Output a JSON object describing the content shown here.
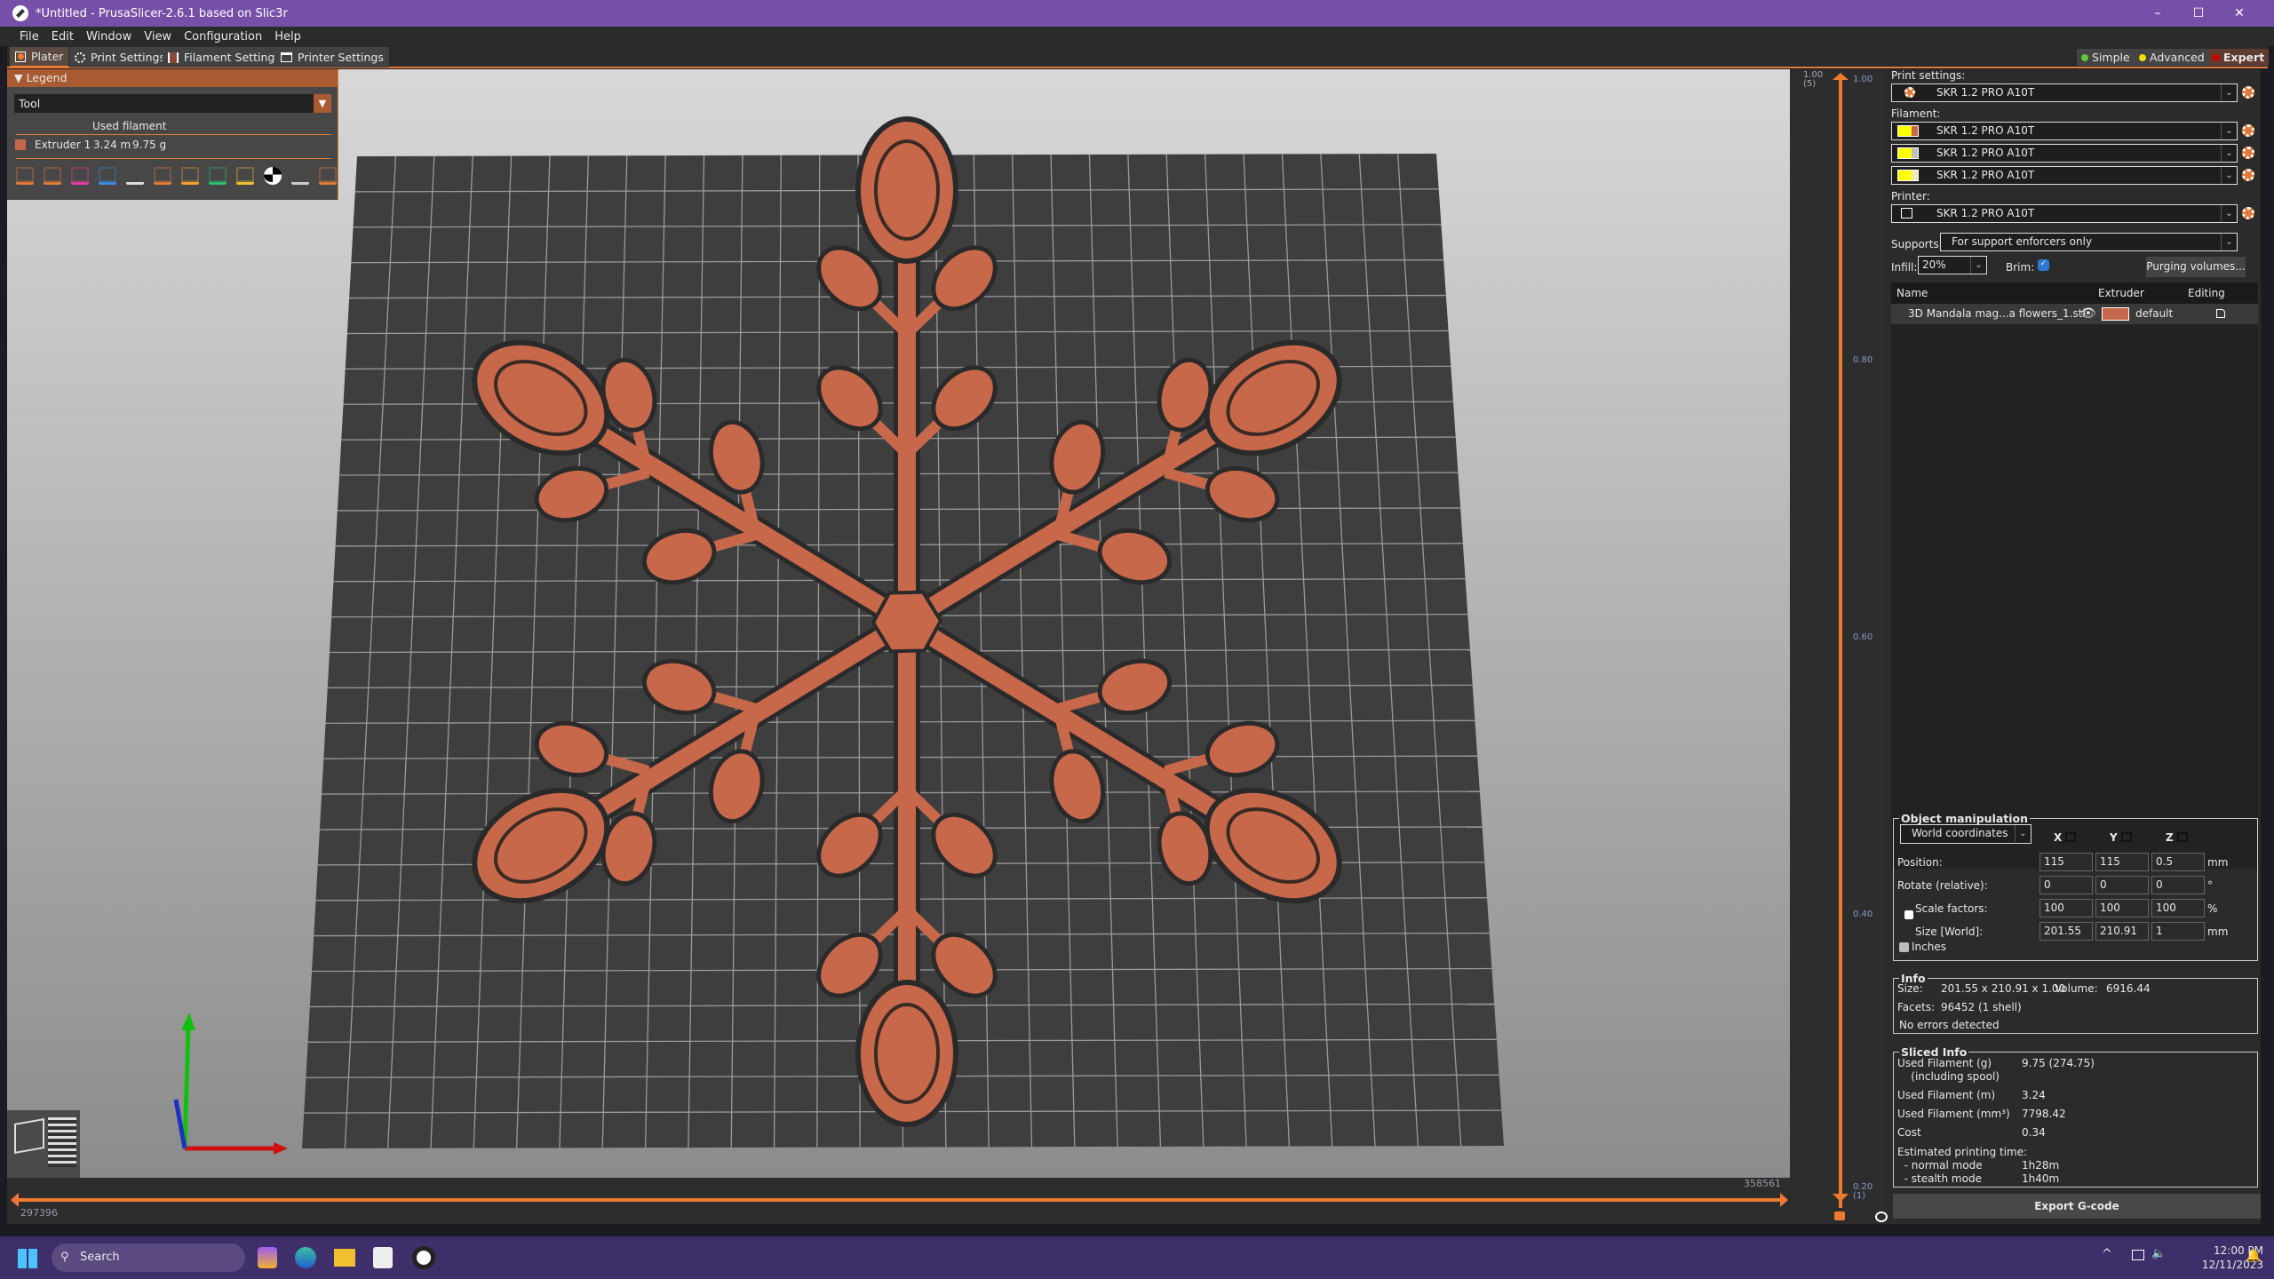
{
  "window": {
    "title": "*Untitled - PrusaSlicer-2.6.1 based on Slic3r",
    "minimize": "–",
    "maximize": "☐",
    "close": "✕"
  },
  "menu": [
    "File",
    "Edit",
    "Window",
    "View",
    "Configuration",
    "Help"
  ],
  "tabs": [
    {
      "label": "Plater",
      "icon": "plater-icon"
    },
    {
      "label": "Print Settings",
      "icon": "gear-icon"
    },
    {
      "label": "Filament Settings",
      "icon": "filament-spool-icon"
    },
    {
      "label": "Printer Settings",
      "icon": "printer-icon"
    }
  ],
  "modes": [
    {
      "label": "Simple",
      "color": "#5cc83a"
    },
    {
      "label": "Advanced",
      "color": "#f2e100"
    },
    {
      "label": "Expert",
      "color": "#d00000"
    }
  ],
  "legend": {
    "title": "Legend",
    "view_type": "Tool",
    "column_header": "Used filament",
    "items": [
      {
        "name": "Extruder 1",
        "length": "3.24 m",
        "weight": "9.75 g",
        "color": "#c8684a"
      }
    ]
  },
  "vertical_slider": {
    "top_label": "1.00",
    "top_sub": "(5)",
    "bottom_label": "0.20",
    "bottom_sub": "(1)",
    "ticks": [
      "1.00",
      "0.80",
      "0.60",
      "0.40"
    ]
  },
  "horizontal_slider": {
    "left_label": "297396",
    "right_label": "358561"
  },
  "sidebar": {
    "print_settings_label": "Print settings:",
    "print_profile": "SKR 1.2 PRO A10T",
    "filament_label": "Filament:",
    "filaments": [
      {
        "name": "SKR 1.2 PRO A10T",
        "color": "#c8684a"
      },
      {
        "name": "SKR 1.2 PRO A10T",
        "color": "#c0c0c0"
      },
      {
        "name": "SKR 1.2 PRO A10T",
        "color": "#eee8b8"
      }
    ],
    "printer_label": "Printer:",
    "printer_profile": "SKR 1.2 PRO A10T",
    "supports_label": "Supports:",
    "supports_value": "For support enforcers only",
    "infill_label": "Infill:",
    "infill_value": "20%",
    "brim_label": "Brim:",
    "brim_checked": true,
    "purging_button": "Purging volumes...",
    "object_list": {
      "headers": [
        "Name",
        "",
        "Extruder",
        "Editing"
      ],
      "rows": [
        {
          "name": "3D Mandala mag...a flowers_1.stl",
          "extruder": "default",
          "color": "#c8684a"
        }
      ]
    },
    "manipulation": {
      "title": "Object manipulation",
      "coord_system": "World coordinates",
      "axes": [
        "X",
        "Y",
        "Z"
      ],
      "rows": [
        {
          "label": "Position:",
          "values": [
            "115",
            "115",
            "0.5"
          ],
          "unit": "mm"
        },
        {
          "label": "Rotate (relative):",
          "values": [
            "0",
            "0",
            "0"
          ],
          "unit": "°"
        },
        {
          "label": "Scale factors:",
          "values": [
            "100",
            "100",
            "100"
          ],
          "unit": "%"
        },
        {
          "label": "Size [World]:",
          "values": [
            "201.55",
            "210.91",
            "1"
          ],
          "unit": "mm"
        }
      ],
      "inches_label": "Inches"
    },
    "info": {
      "title": "Info",
      "size_label": "Size:",
      "size": "201.55 x 210.91 x 1.00",
      "volume_label": "Volume:",
      "volume": "6916.44",
      "facets_label": "Facets:",
      "facets": "96452 (1 shell)",
      "status": "No errors detected"
    },
    "sliced": {
      "title": "Sliced Info",
      "rows": [
        [
          "Used Filament (g)",
          "9.75 (274.75)"
        ],
        [
          "    (including spool)",
          ""
        ],
        [
          "Used Filament (m)",
          "3.24"
        ],
        [
          "Used Filament (mm³)",
          "7798.42"
        ],
        [
          "Cost",
          "0.34"
        ],
        [
          "Estimated printing time:",
          ""
        ],
        [
          "  - normal mode",
          "1h28m"
        ],
        [
          "  - stealth mode",
          "1h40m"
        ]
      ]
    },
    "export_button": "Export G-code"
  },
  "taskbar": {
    "search": "Search",
    "time": "12:00 PM",
    "date": "12/11/2023"
  }
}
